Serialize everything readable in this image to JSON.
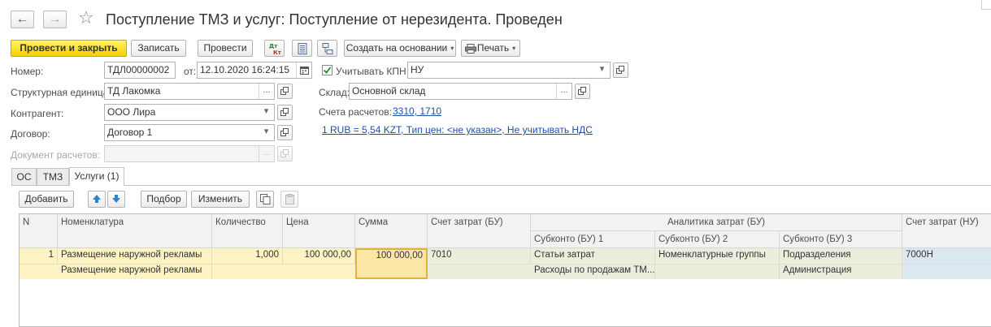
{
  "window": {
    "title": "Поступление ТМЗ и услуг: Поступление от нерезидента. Проведен",
    "back_glyph": "←",
    "forward_glyph": "→",
    "favorite_glyph": "☆"
  },
  "toolbar": {
    "post_close_label": "Провести и закрыть",
    "save_label": "Записать",
    "post_label": "Провести",
    "create_based_label": "Создать на основании",
    "print_label": "Печать",
    "caret": "▾"
  },
  "form": {
    "number_label": "Номер:",
    "number_value": "ТДЛ00000002",
    "date_label": "от:",
    "date_value": "12.10.2020 16:24:15",
    "kpn_label": "Учитывать КПН",
    "kpn_checked": true,
    "kpn_value": "НУ",
    "unit_label": "Структурная единица:",
    "unit_value": "ТД Лакомка",
    "warehouse_label": "Склад:",
    "warehouse_value": "Основной склад",
    "counterparty_label": "Контрагент:",
    "counterparty_value": "ООО Лира",
    "accounts_label": "Счета расчетов:",
    "accounts_link": "3310, 1710",
    "contract_label": "Договор:",
    "contract_value": "Договор 1",
    "rate_link": "1 RUB = 5,54 KZT, Тип цен: <не указан>, Не учитывать НДС",
    "settlement_doc_label": "Документ расчетов:",
    "settlement_doc_value": "",
    "ellipsis": "...",
    "caret": "▾"
  },
  "tabs": [
    {
      "label": "ОС",
      "active": false
    },
    {
      "label": "ТМЗ",
      "active": false
    },
    {
      "label": "Услуги (1)",
      "active": true
    }
  ],
  "table_toolbar": {
    "add_label": "Добавить",
    "pick_label": "Подбор",
    "change_label": "Изменить"
  },
  "table": {
    "headers": {
      "n": "N",
      "item": "Номенклатура",
      "qty": "Количество",
      "price": "Цена",
      "sum": "Сумма",
      "cost_acc_bu": "Счет затрат (БУ)",
      "analytics_bu": "Аналитика затрат (БУ)",
      "subconto1": "Субконто (БУ) 1",
      "subconto2": "Субконто (БУ) 2",
      "subconto3": "Субконто (БУ) 3",
      "cost_acc_nu": "Счет затрат (НУ)"
    },
    "rows": [
      {
        "n": "1",
        "item": "Размещение наружной рекламы",
        "item_content": "Размещение наружной рекламы",
        "qty": "1,000",
        "price": "100 000,00",
        "sum": "100 000,00",
        "cost_acc_bu": "7010",
        "subconto1": "Статьи затрат",
        "subconto1_value": "Расходы по продажам ТМ...",
        "subconto2": "Номенклатурные группы",
        "subconto2_value": "",
        "subconto3": "Подразделения",
        "subconto3_value": "Администрация",
        "cost_acc_nu": "7000Н"
      }
    ]
  },
  "colors": {
    "primary_button": "#f3d000",
    "row_highlight": "#fdf3c3",
    "row_account": "#ebeedd",
    "selected_cell": "#fce6a6",
    "nu_cell": "#dbe8f0",
    "link": "#1f4fa8"
  }
}
